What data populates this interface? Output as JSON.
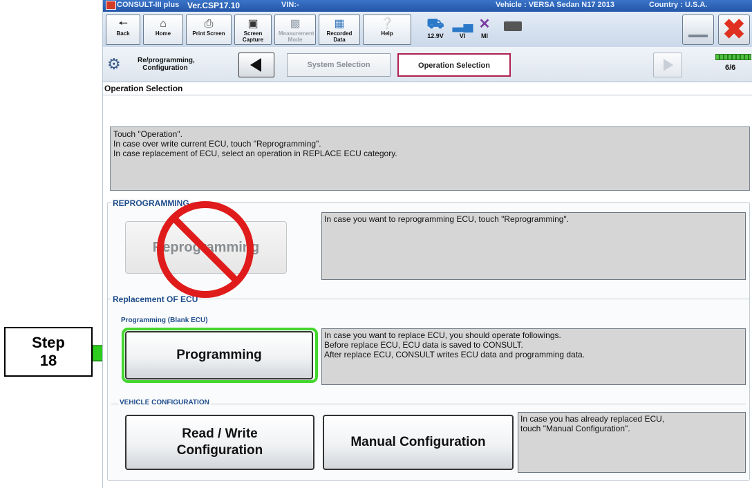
{
  "annotation": {
    "step_label": "Step",
    "step_number": "18",
    "arrow_color": "#2ecc1e",
    "highlight_color": "#44d62e",
    "prohibited_color": "#e01b1b"
  },
  "titlebar": {
    "app_name": "CONSULT-III plus",
    "version": "Ver.CSP17.10",
    "vin_label": "VIN:-",
    "vehicle": "Vehicle : VERSA Sedan N17 2013",
    "country": "Country : U.S.A."
  },
  "toolbar": {
    "buttons": [
      {
        "label": "Back",
        "icon": "back-arrow-icon"
      },
      {
        "label": "Home",
        "icon": "home-icon"
      },
      {
        "label": "Print Screen",
        "icon": "printer-icon"
      },
      {
        "label": "Screen Capture",
        "icon": "camera-icon"
      },
      {
        "label": "Measurement Mode",
        "icon": "measurement-icon",
        "disabled": true
      },
      {
        "label": "Recorded Data",
        "icon": "recorded-data-icon"
      },
      {
        "label": "Help",
        "icon": "help-icon"
      }
    ],
    "status": {
      "battery_voltage": "12.9V",
      "vi_label": "VI",
      "mi_label": "MI"
    }
  },
  "navbar": {
    "section_label": "Re/programming, Configuration",
    "crumbs": [
      "System Selection",
      "Operation Selection"
    ],
    "active_crumb": "Operation Selection",
    "progress_text": "6/6",
    "progress_fraction": 1.0
  },
  "page": {
    "title": "Operation Selection",
    "instructions": [
      "Touch \"Operation\".",
      "In case over write current ECU, touch \"Reprogramming\".",
      "In case replacement of ECU, select an operation in REPLACE ECU category."
    ]
  },
  "reprogramming": {
    "title": "REPROGRAMMING",
    "button_label": "Reprogramming",
    "description": "In case you want to reprogramming ECU, touch \"Reprogramming\"."
  },
  "replacement": {
    "title": "Replacement OF ECU",
    "subtitle": "Programming (Blank ECU)",
    "button_label": "Programming",
    "description": [
      "In case you want to replace ECU, you should operate followings.",
      "Before replace ECU, ECU data is saved to CONSULT.",
      "After replace ECU, CONSULT writes ECU data and programming data."
    ]
  },
  "vehicle_config": {
    "title": "VEHICLE CONFIGURATION",
    "read_write_line1": "Read / Write",
    "read_write_line2": "Configuration",
    "manual_label": "Manual Configuration",
    "description": [
      "In case you has already replaced ECU,",
      "touch \"Manual Configuration\"."
    ]
  }
}
